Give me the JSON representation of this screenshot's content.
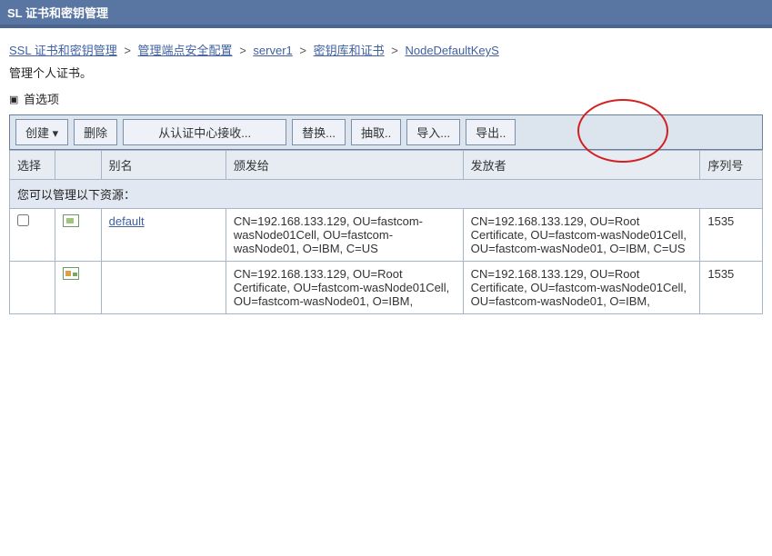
{
  "header": {
    "title": "SL 证书和密钥管理"
  },
  "breadcrumb": {
    "items": [
      "SSL 证书和密钥管理",
      "管理端点安全配置",
      "server1",
      "密钥库和证书",
      "NodeDefaultKeyS"
    ],
    "separator": ">"
  },
  "subtitle": "管理个人证书。",
  "preferences_label": "首选项",
  "toolbar": {
    "create": "创建",
    "delete": "删除",
    "receive_from_ca": "从认证中心接收...",
    "replace": "替换...",
    "extract": "抽取..",
    "import": "导入...",
    "export": "导出.."
  },
  "table": {
    "headers": {
      "select": "选择",
      "icon": "",
      "alias": "别名",
      "issued_to": "颁发给",
      "issued_by": "发放者",
      "serial": "序列号"
    },
    "section_label": "您可以管理以下资源：",
    "rows": [
      {
        "alias": "default",
        "issued_to": "CN=192.168.133.129, OU=fastcom-wasNode01Cell, OU=fastcom-wasNode01, O=IBM, C=US",
        "issued_by": "CN=192.168.133.129, OU=Root Certificate, OU=fastcom-wasNode01Cell, OU=fastcom-wasNode01, O=IBM, C=US",
        "serial": "1535"
      },
      {
        "alias": "",
        "issued_to": "CN=192.168.133.129, OU=Root Certificate, OU=fastcom-wasNode01Cell, OU=fastcom-wasNode01, O=IBM,",
        "issued_by": "CN=192.168.133.129, OU=Root Certificate, OU=fastcom-wasNode01Cell, OU=fastcom-wasNode01, O=IBM,",
        "serial": "1535"
      }
    ]
  }
}
